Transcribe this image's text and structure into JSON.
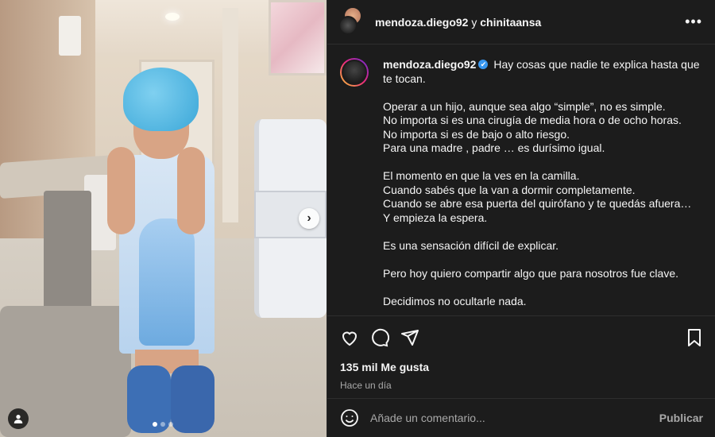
{
  "header": {
    "author": "mendoza.diego92",
    "connector": "y",
    "coauthor": "chinitaansa",
    "more_icon": "more-horizontal-icon"
  },
  "caption": {
    "username": "mendoza.diego92",
    "verified_icon": "✔",
    "lines": [
      "Hay cosas que nadie te explica hasta que te tocan.",
      "Operar a un hijo, aunque sea algo “simple”, no es simple.\nNo importa si es una cirugía de media hora o de ocho horas.\nNo importa si es de bajo o alto riesgo.\nPara una madre , padre … es durísimo igual.",
      "El momento en que la ves en la camilla.\nCuando sabés que la van a dormir completamente.\nCuando se abre esa puerta del quirófano y te quedás afuera…\nY empieza la espera.",
      "Es una sensación difícil de explicar.",
      "Pero hoy quiero compartir algo que para nosotros fue clave.",
      "Decidimos no ocultarle nada."
    ]
  },
  "photo": {
    "next_icon": "›",
    "tag_icon": "user-tag-icon",
    "carousel_count": 3,
    "carousel_active": 0
  },
  "actions": {
    "likes": "135 mil Me gusta",
    "time": "Hace un día"
  },
  "comment": {
    "placeholder": "Añade un comentario...",
    "publish_label": "Publicar"
  }
}
